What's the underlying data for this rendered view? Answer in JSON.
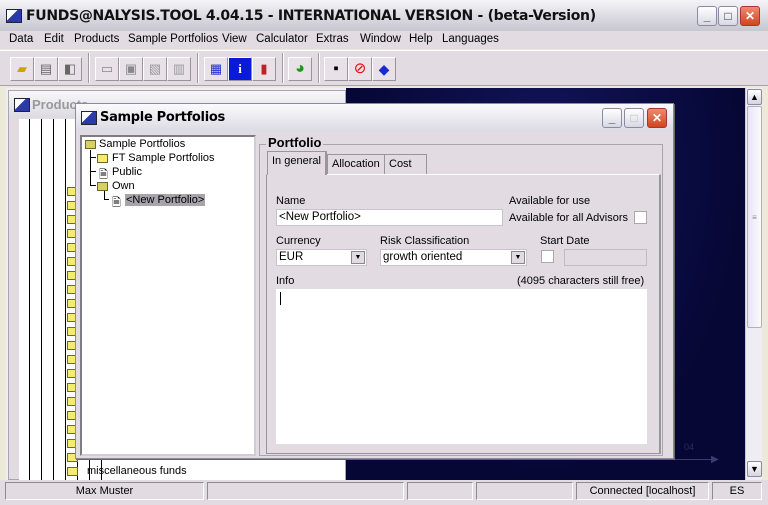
{
  "app": {
    "title": "FUNDS@NALYSIS.TOOL 4.04.15 - INTERNATIONAL VERSION - (beta-Version)"
  },
  "menu": [
    "Data",
    "Edit",
    "Products",
    "Sample Portfolios",
    "View",
    "Calculator",
    "Extras",
    "Window",
    "Help",
    "Languages"
  ],
  "toolbar": {
    "icons": [
      "open-folder-icon",
      "copy-icon",
      "import-icon",
      "print-icon",
      "print-preview-icon",
      "image-icon",
      "card-icon",
      "table-icon",
      "info-icon",
      "chart-icon",
      "pie-chart-icon",
      "save-icon",
      "cancel-icon",
      "eraser-icon"
    ]
  },
  "products_window": {
    "title": "Products",
    "items": [
      "miscellaneous funds"
    ]
  },
  "dialog": {
    "title": "Sample Portfolios",
    "tree": [
      {
        "label": "Sample Portfolios"
      },
      {
        "label": "FT Sample Portfolios"
      },
      {
        "label": "Public"
      },
      {
        "label": "Own"
      },
      {
        "label": "<New Portfolio>",
        "selected": true
      }
    ],
    "group_label": "Portfolio",
    "tabs": [
      "In general",
      "Allocation",
      "Cost"
    ],
    "active_tab": "In general",
    "name_label": "Name",
    "name_value": "<New Portfolio>",
    "available_label": "Available for use",
    "advisors_label": "Available for all Advisors",
    "advisors_checked": false,
    "currency_label": "Currency",
    "currency_value": "EUR",
    "risk_label": "Risk Classification",
    "risk_value": "growth oriented",
    "start_label": "Start Date",
    "start_checked": false,
    "start_value": "",
    "info_label": "Info",
    "info_free": "(4095 characters still free)",
    "info_value": ""
  },
  "chart_bg": {
    "tick_label": "04"
  },
  "status": {
    "user": "Max Muster",
    "connection": "Connected [localhost]",
    "lang": "ES"
  }
}
